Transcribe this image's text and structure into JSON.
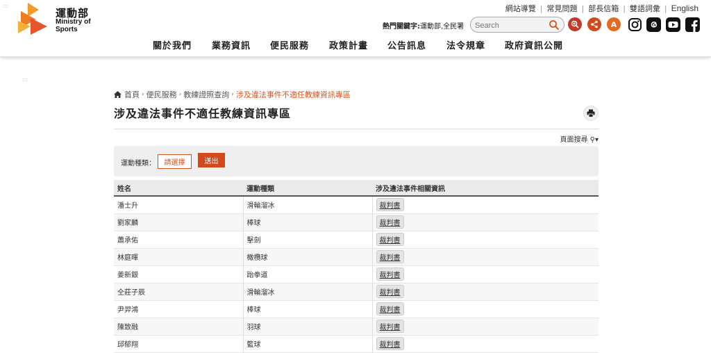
{
  "header": {
    "logo_zh": "運動部",
    "logo_en_line1": "Ministry of",
    "logo_en_line2": "Sports",
    "top_links": [
      "網站導覽",
      "常見問題",
      "部長信箱",
      "雙語詞彙",
      "English"
    ],
    "hot_keywords_label": "熱門關鍵字:",
    "hot_keywords": "運動部,全民署",
    "search_placeholder": "Search",
    "font_size_letter": "A",
    "colors": {
      "accent": "#d9531e",
      "icon_bg": "#d24a1b"
    }
  },
  "nav": [
    "關於我們",
    "業務資訊",
    "便民服務",
    "政策計畫",
    "公告訊息",
    "法令規章",
    "政府資訊公開"
  ],
  "breadcrumb": [
    "首頁",
    "便民服務",
    "教練證照查詢",
    "涉及違法事件不適任教練資訊專區"
  ],
  "page_title": "涉及違法事件不適任教練資訊專區",
  "page_search_label": "頁面搜尋",
  "filter": {
    "label": "運動種類：",
    "select_label": "請選擇",
    "submit_label": "送出"
  },
  "table": {
    "headers": [
      "姓名",
      "運動種類",
      "涉及違法事件相關資訊"
    ],
    "rows": [
      {
        "name": "潘士升",
        "sport": "滑輪溜冰",
        "doc": "裁判書"
      },
      {
        "name": "劉家麟",
        "sport": "棒球",
        "doc": "裁判書"
      },
      {
        "name": "蕭承佑",
        "sport": "擊劍",
        "doc": "裁判書"
      },
      {
        "name": "林庭暉",
        "sport": "橄欖球",
        "doc": "裁判書"
      },
      {
        "name": "姜新銀",
        "sport": "跆拳道",
        "doc": "裁判書"
      },
      {
        "name": "仝莊子辰",
        "sport": "滑輪溜冰",
        "doc": "裁判書"
      },
      {
        "name": "尹羿鴻",
        "sport": "棒球",
        "doc": "裁判書"
      },
      {
        "name": "陳致融",
        "sport": "羽球",
        "doc": "裁判書"
      },
      {
        "name": "邱郁翔",
        "sport": "籃球",
        "doc": "裁判書"
      }
    ]
  }
}
